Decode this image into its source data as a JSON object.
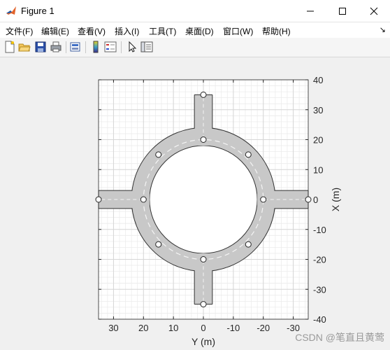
{
  "window": {
    "title": "Figure 1"
  },
  "menu": [
    {
      "id": "file",
      "label": "文件(F)"
    },
    {
      "id": "edit",
      "label": "编辑(E)"
    },
    {
      "id": "view",
      "label": "查看(V)"
    },
    {
      "id": "insert",
      "label": "插入(I)"
    },
    {
      "id": "tools",
      "label": "工具(T)"
    },
    {
      "id": "desktop",
      "label": "桌面(D)"
    },
    {
      "id": "window",
      "label": "窗口(W)"
    },
    {
      "id": "help",
      "label": "帮助(H)"
    }
  ],
  "toolbar": {
    "icons": [
      "new-figure-icon",
      "open-file-icon",
      "save-icon",
      "print-icon",
      "print-preview-icon",
      "colorbar-icon",
      "legend-icon",
      "select-arrow-icon",
      "property-inspector-icon"
    ]
  },
  "chart_data": {
    "type": "scatter",
    "xlabel": "Y (m)",
    "ylabel": "X (m)",
    "xlim": [
      35,
      -35
    ],
    "ylim": [
      -40,
      40
    ],
    "x_axis_reversed": true,
    "y_axis_location": "right",
    "x_ticks": [
      30,
      20,
      10,
      0,
      -10,
      -20,
      -30
    ],
    "y_ticks": [
      40,
      30,
      20,
      10,
      0,
      -10,
      -20,
      -30,
      -40
    ],
    "grid": "major and minor",
    "road": {
      "ring_outer_radius": 24,
      "ring_inner_radius": 18,
      "ring_centerline_radius": 20,
      "spur_half_width": 3,
      "spur_end": 35
    },
    "points": [
      {
        "y": 0,
        "x": 35
      },
      {
        "y": 0,
        "x": 20
      },
      {
        "y": 15,
        "x": 15
      },
      {
        "y": -15,
        "x": 15
      },
      {
        "y": 35,
        "x": 0
      },
      {
        "y": 20,
        "x": 0
      },
      {
        "y": -20,
        "x": 0
      },
      {
        "y": -35,
        "x": 0
      },
      {
        "y": 15,
        "x": -15
      },
      {
        "y": -15,
        "x": -15
      },
      {
        "y": 0,
        "x": -20
      },
      {
        "y": 0,
        "x": -35
      }
    ],
    "marker_color": "#ffffff",
    "road_color": "#c8c8c8",
    "edge_color": "#333333"
  },
  "watermark": "CSDN @笔直且黄莺"
}
